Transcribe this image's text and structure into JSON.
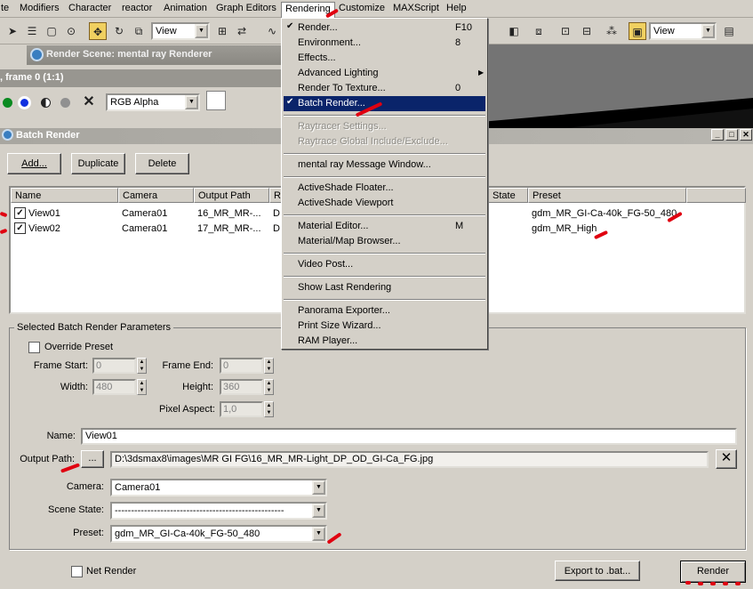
{
  "menubar": [
    "te",
    "Modifiers",
    "Character",
    "reactor",
    "Animation",
    "Graph Editors",
    "Rendering",
    "Customize",
    "MAXScript",
    "Help"
  ],
  "toolbar": {
    "view_left": "View",
    "view_right": "View"
  },
  "render_scene_title": "Render Scene: mental ray Renderer",
  "frame_title": ", frame 0 (1:1)",
  "channel_select": "RGB Alpha",
  "batch": {
    "title": "Batch Render",
    "add": "Add...",
    "duplicate": "Duplicate",
    "delete": "Delete",
    "columns": [
      "Name",
      "Camera",
      "Output Path",
      "R",
      "State",
      "Preset"
    ],
    "rows": [
      {
        "checked": true,
        "name": "View01",
        "camera": "Camera01",
        "output": "16_MR_MR-...",
        "r": "D",
        "preset": "gdm_MR_GI-Ca-40k_FG-50_480"
      },
      {
        "checked": true,
        "name": "View02",
        "camera": "Camera01",
        "output": "17_MR_MR-...",
        "r": "D",
        "preset": "gdm_MR_High"
      }
    ],
    "group_label": "Selected Batch Render Parameters",
    "override_preset": "Override Preset",
    "frame_start_label": "Frame Start:",
    "frame_start": "0",
    "frame_end_label": "Frame End:",
    "frame_end": "0",
    "width_label": "Width:",
    "width": "480",
    "height_label": "Height:",
    "height": "360",
    "pixel_aspect_label": "Pixel Aspect:",
    "pixel_aspect": "1,0",
    "name_label": "Name:",
    "name": "View01",
    "output_path_label": "Output Path:",
    "browse": "...",
    "output_path": "D:\\3dsmax8\\images\\MR GI FG\\16_MR_MR-Light_DP_OD_GI-Ca_FG.jpg",
    "camera_label": "Camera:",
    "camera": "Camera01",
    "scene_state_label": "Scene State:",
    "scene_state": "----------------------------------------------------",
    "preset_label": "Preset:",
    "preset": "gdm_MR_GI-Ca-40k_FG-50_480",
    "net_render": "Net Render",
    "export": "Export to .bat...",
    "render": "Render"
  },
  "rendering_menu": [
    {
      "label": "Render...",
      "shortcut": "F10",
      "check": true
    },
    {
      "label": "Environment...",
      "shortcut": "8"
    },
    {
      "label": "Effects..."
    },
    {
      "label": "Advanced Lighting",
      "submenu": true
    },
    {
      "label": "Render To Texture...",
      "shortcut": "0"
    },
    {
      "label": "Batch Render...",
      "check": true,
      "selected": true
    },
    {
      "sep": true
    },
    {
      "label": "Raytracer Settings...",
      "disabled": true
    },
    {
      "label": "Raytrace Global Include/Exclude...",
      "disabled": true
    },
    {
      "sep": true
    },
    {
      "label": "mental ray Message Window..."
    },
    {
      "sep": true
    },
    {
      "label": "ActiveShade Floater..."
    },
    {
      "label": "ActiveShade Viewport"
    },
    {
      "sep": true
    },
    {
      "label": "Material Editor...",
      "shortcut": "M"
    },
    {
      "label": "Material/Map Browser..."
    },
    {
      "sep": true
    },
    {
      "label": "Video Post..."
    },
    {
      "sep": true
    },
    {
      "label": "Show Last Rendering"
    },
    {
      "sep": true
    },
    {
      "label": "Panorama Exporter..."
    },
    {
      "label": "Print Size Wizard..."
    },
    {
      "label": "RAM Player..."
    }
  ]
}
